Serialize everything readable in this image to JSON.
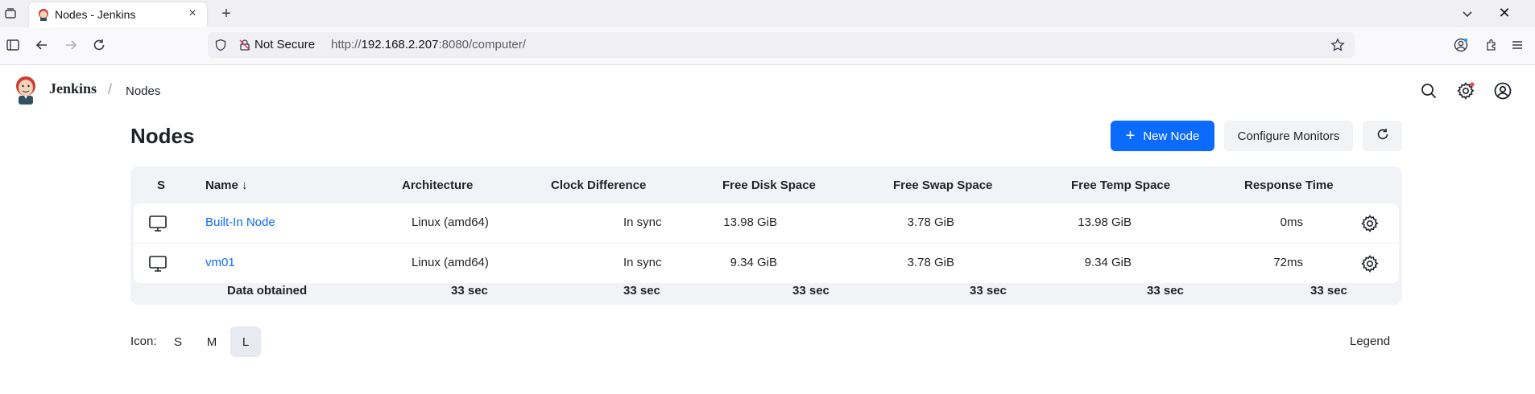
{
  "browser": {
    "tab_title": "Nodes - Jenkins",
    "security_label": "Not Secure",
    "url_prefix": "http://",
    "url_host": "192.168.2.207",
    "url_rest": ":8080/computer/"
  },
  "header": {
    "brand": "Jenkins",
    "separator": "/",
    "breadcrumb": "Nodes"
  },
  "page": {
    "title": "Nodes",
    "new_node_label": "New Node",
    "configure_monitors_label": "Configure Monitors"
  },
  "table": {
    "columns": [
      "S",
      "Name",
      "Architecture",
      "Clock Difference",
      "Free Disk Space",
      "Free Swap Space",
      "Free Temp Space",
      "Response Time"
    ],
    "sort_indicator": "↓",
    "rows": [
      {
        "name": "Built-In Node",
        "architecture": "Linux (amd64)",
        "clock": "In sync",
        "disk": "13.98 GiB",
        "swap": "3.78 GiB",
        "temp": "13.98 GiB",
        "response": "0ms"
      },
      {
        "name": "vm01",
        "architecture": "Linux (amd64)",
        "clock": "In sync",
        "disk": "9.34 GiB",
        "swap": "3.78 GiB",
        "temp": "9.34 GiB",
        "response": "72ms"
      }
    ],
    "footer": {
      "label": "Data obtained",
      "architecture": "33 sec",
      "clock": "33 sec",
      "disk": "33 sec",
      "swap": "33 sec",
      "temp": "33 sec",
      "response": "33 sec"
    }
  },
  "icon_size": {
    "label": "Icon:",
    "options": [
      "S",
      "M",
      "L"
    ],
    "selected": "L"
  },
  "legend_label": "Legend",
  "colors": {
    "primary": "#0b6bff",
    "link": "#0b6bff",
    "notification_dot": "#e5484d"
  }
}
